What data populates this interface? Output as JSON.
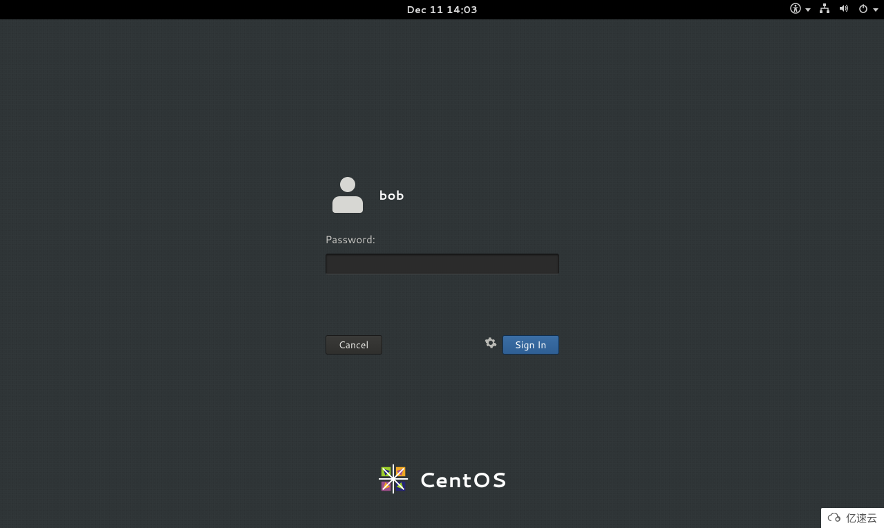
{
  "topbar": {
    "datetime": "Dec 11  14:03",
    "accessibility_icon": "accessibility-icon",
    "network_icon": "wired-network-icon",
    "volume_icon": "volume-high-icon",
    "power_icon": "power-icon"
  },
  "login": {
    "username": "bob",
    "password_label": "Password:",
    "password_value": "",
    "cancel_label": "Cancel",
    "signin_label": "Sign In",
    "session_gear_icon": "gear-icon"
  },
  "distro": {
    "name": "CentOS",
    "logo_icon": "centos-logo-icon"
  },
  "watermark": {
    "text": "亿速云"
  }
}
